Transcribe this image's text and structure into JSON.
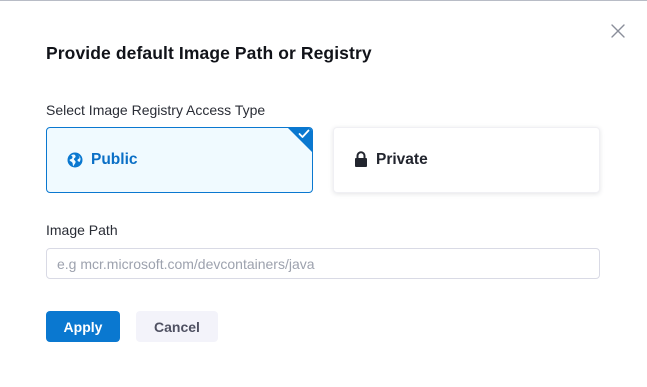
{
  "dialog": {
    "title": "Provide default Image Path or Registry",
    "close_icon": "close-icon"
  },
  "access_type": {
    "label": "Select Image Registry Access Type",
    "options": [
      {
        "label": "Public",
        "icon": "globe-icon",
        "selected": true
      },
      {
        "label": "Private",
        "icon": "lock-icon",
        "selected": false
      }
    ],
    "accent_color": "#0a78d0"
  },
  "image_path": {
    "label": "Image Path",
    "value": "",
    "placeholder": "e.g mcr.microsoft.com/devcontainers/java"
  },
  "actions": {
    "apply_label": "Apply",
    "cancel_label": "Cancel"
  }
}
